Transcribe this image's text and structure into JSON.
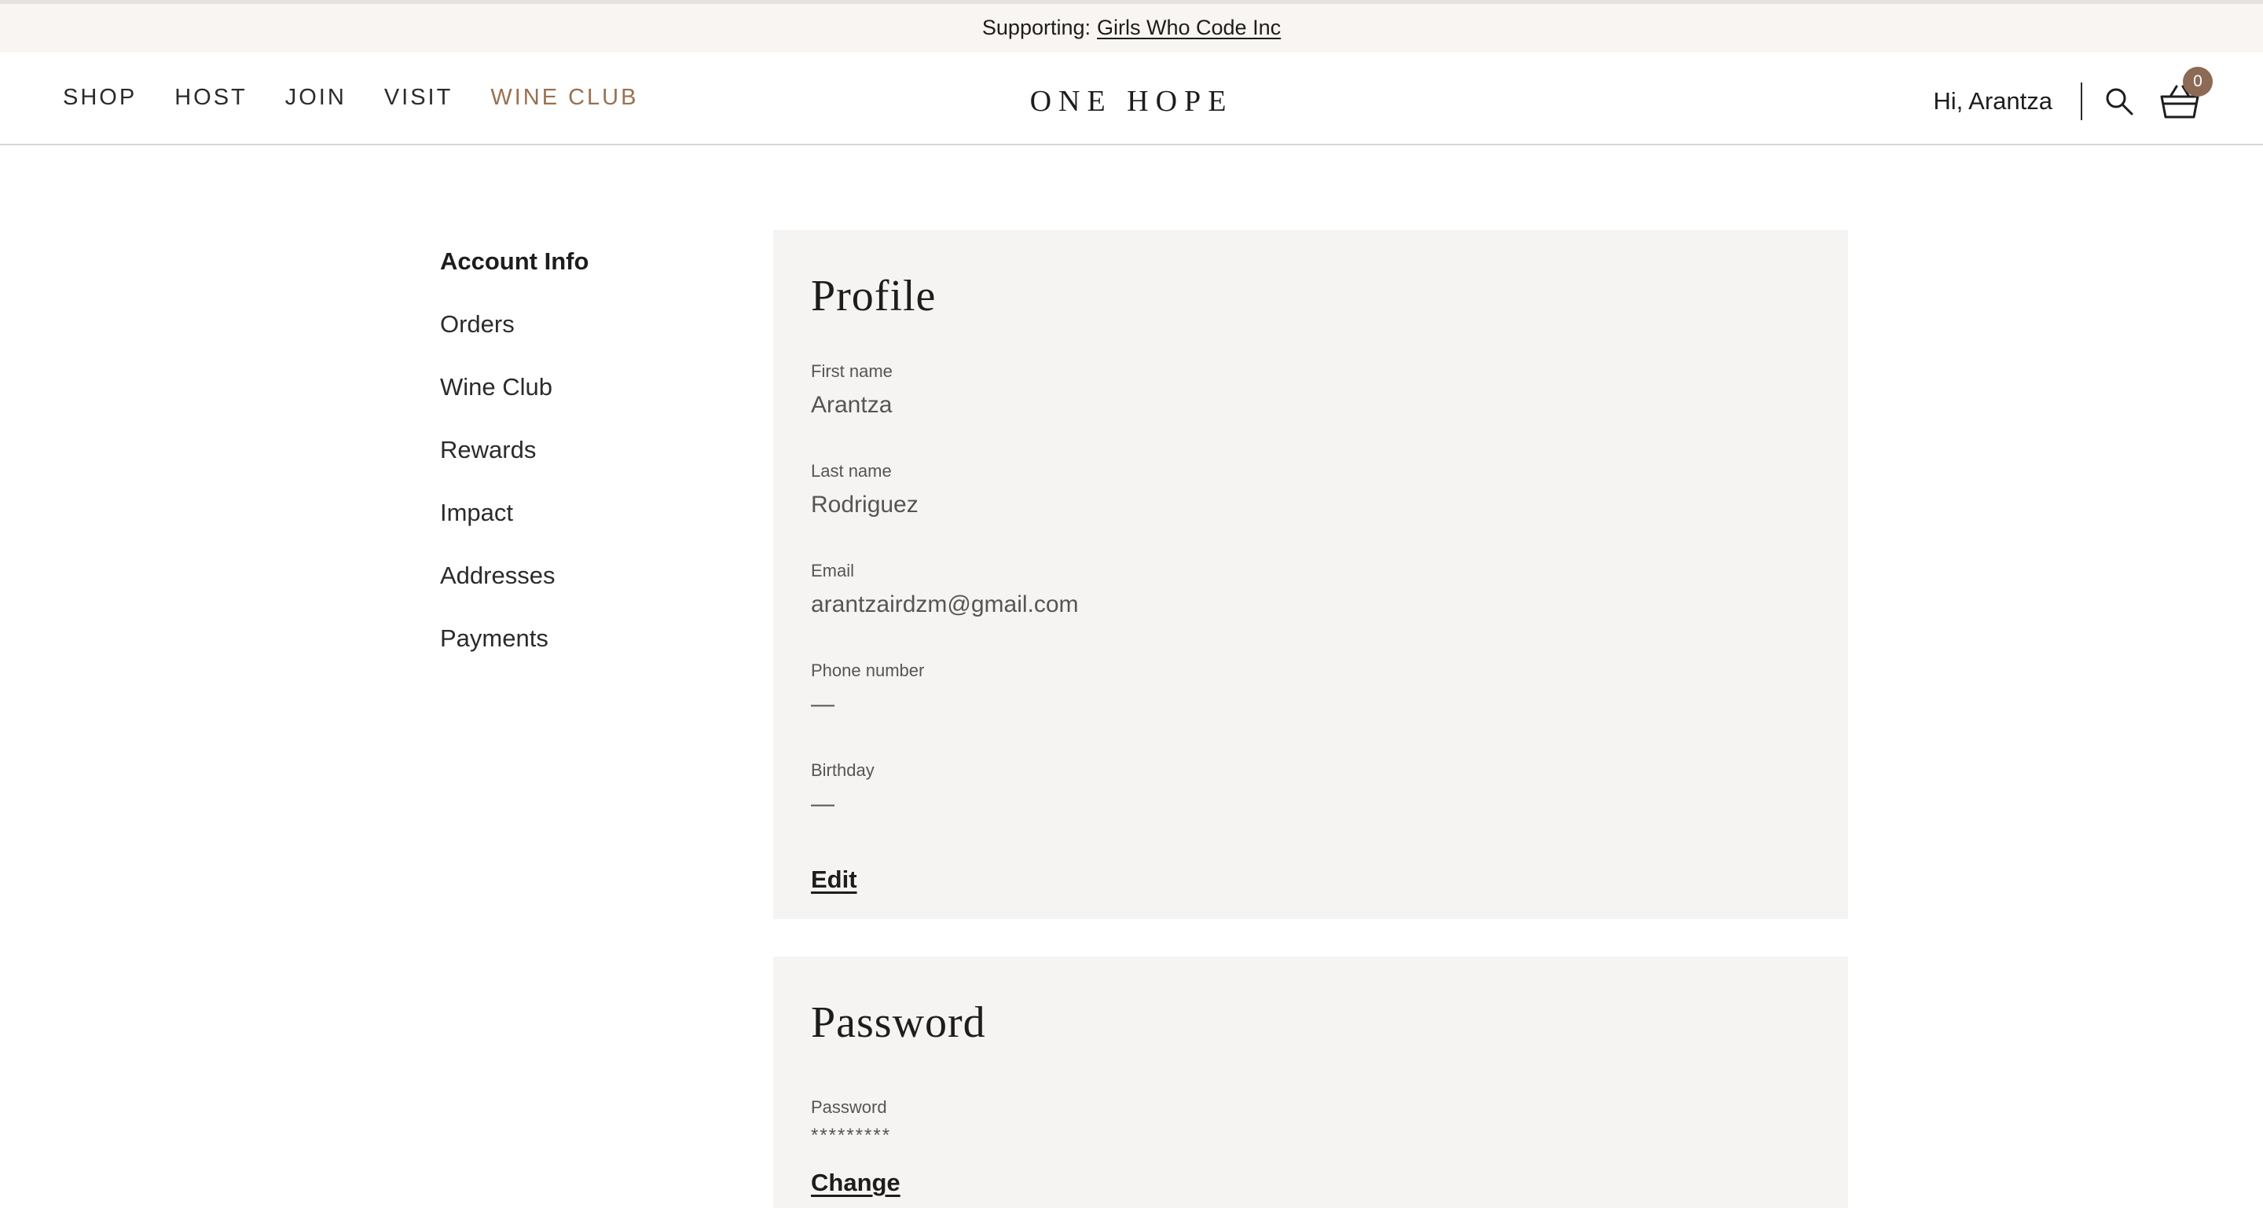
{
  "topbar": {
    "prefix": "Supporting:",
    "link": "Girls Who Code Inc"
  },
  "nav": {
    "items": [
      {
        "label": "SHOP"
      },
      {
        "label": "HOST"
      },
      {
        "label": "JOIN"
      },
      {
        "label": "VISIT"
      },
      {
        "label": "WINE CLUB"
      }
    ]
  },
  "logo": "ONE HOPE",
  "header": {
    "greeting": "Hi, Arantza",
    "cart_count": "0"
  },
  "sidebar": {
    "items": [
      {
        "label": "Account Info",
        "active": true
      },
      {
        "label": "Orders"
      },
      {
        "label": "Wine Club"
      },
      {
        "label": "Rewards"
      },
      {
        "label": "Impact"
      },
      {
        "label": "Addresses"
      },
      {
        "label": "Payments"
      }
    ]
  },
  "profile": {
    "title": "Profile",
    "fields": [
      {
        "label": "First name",
        "value": "Arantza"
      },
      {
        "label": "Last name",
        "value": "Rodriguez"
      },
      {
        "label": "Email",
        "value": "arantzairdzm@gmail.com"
      },
      {
        "label": "Phone number",
        "value": "—"
      },
      {
        "label": "Birthday",
        "value": "—"
      }
    ],
    "edit_label": "Edit"
  },
  "password": {
    "title": "Password",
    "label": "Password",
    "value": "*********",
    "change_label": "Change"
  },
  "colors": {
    "accent": "#99714f",
    "badge": "#8d6a55",
    "card_bg": "#f5f4f2",
    "topbar_bg": "#f8f5f2"
  }
}
